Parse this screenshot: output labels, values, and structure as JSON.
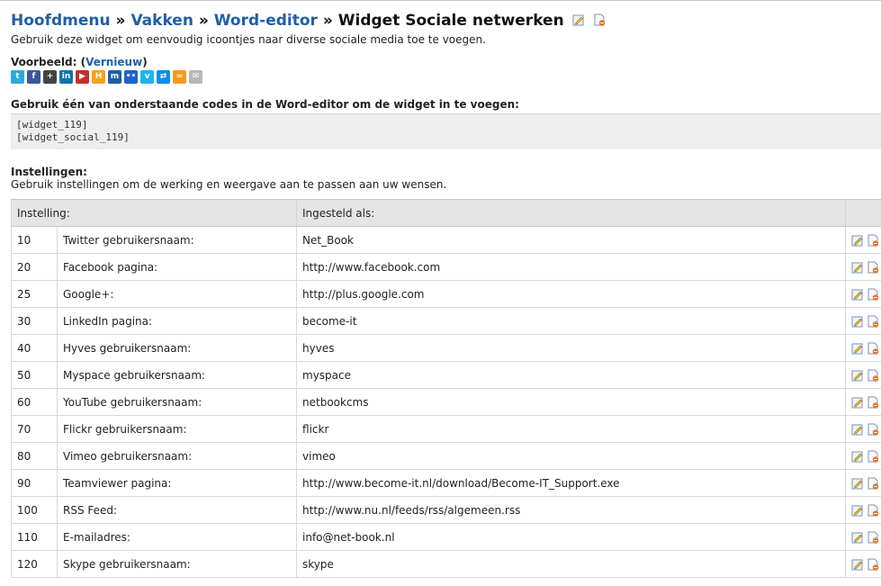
{
  "breadcrumb": {
    "home": "Hoofdmenu",
    "sep1": "»",
    "subjects": "Vakken",
    "sep2": "»",
    "editor": "Word-editor",
    "sep3": "»",
    "current": "Widget Sociale netwerken"
  },
  "intro": "Gebruik deze widget om eenvoudig icoontjes naar diverse sociale media toe te voegen.",
  "preview": {
    "label": "Voorbeeld:",
    "open": "(",
    "refresh_link": "Vernieuw",
    "close": ")",
    "icons": [
      {
        "name": "twitter-icon",
        "glyph": "t",
        "color": "#2aa9e0"
      },
      {
        "name": "facebook-icon",
        "glyph": "f",
        "color": "#3b5998"
      },
      {
        "name": "google-plus-icon",
        "glyph": "+",
        "color": "#444444"
      },
      {
        "name": "linkedin-icon",
        "glyph": "in",
        "color": "#0e76a8"
      },
      {
        "name": "youtube-icon",
        "glyph": "▶",
        "color": "#c4302b"
      },
      {
        "name": "hyves-icon",
        "glyph": "H",
        "color": "#f7a21b"
      },
      {
        "name": "myspace-icon",
        "glyph": "m",
        "color": "#1b5ea5"
      },
      {
        "name": "flickr-icon",
        "glyph": "••",
        "color": "#1e64c8"
      },
      {
        "name": "vimeo-icon",
        "glyph": "v",
        "color": "#1ab7ea"
      },
      {
        "name": "teamviewer-icon",
        "glyph": "⇄",
        "color": "#0e8ee9"
      },
      {
        "name": "rss-icon",
        "glyph": "≈",
        "color": "#f8991d"
      },
      {
        "name": "email-icon",
        "glyph": "✉",
        "color": "#b8b8b8"
      }
    ]
  },
  "codes": {
    "title": "Gebruik één van onderstaande codes in de Word-editor om de widget in te voegen:",
    "lines": [
      "[widget_119]",
      "[widget_social_119]"
    ]
  },
  "settings": {
    "title": "Instellingen:",
    "description": "Gebruik instellingen om de werking en weergave aan te passen aan uw wensen.",
    "col_setting": "Instelling:",
    "col_value": "Ingesteld als:",
    "rows": [
      {
        "order": "10",
        "name": "Twitter gebruikersnaam:",
        "value": "Net_Book"
      },
      {
        "order": "20",
        "name": "Facebook pagina:",
        "value": "http://www.facebook.com"
      },
      {
        "order": "25",
        "name": "Google+:",
        "value": "http://plus.google.com"
      },
      {
        "order": "30",
        "name": "LinkedIn pagina:",
        "value": "become-it"
      },
      {
        "order": "40",
        "name": "Hyves gebruikersnaam:",
        "value": "hyves"
      },
      {
        "order": "50",
        "name": "Myspace gebruikersnaam:",
        "value": "myspace"
      },
      {
        "order": "60",
        "name": "YouTube gebruikersnaam:",
        "value": "netbookcms"
      },
      {
        "order": "70",
        "name": "Flickr gebruikersnaam:",
        "value": "flickr"
      },
      {
        "order": "80",
        "name": "Vimeo gebruikersnaam:",
        "value": "vimeo"
      },
      {
        "order": "90",
        "name": "Teamviewer pagina:",
        "value": "http://www.become-it.nl/download/Become-IT_Support.exe"
      },
      {
        "order": "100",
        "name": "RSS Feed:",
        "value": "http://www.nu.nl/feeds/rss/algemeen.rss"
      },
      {
        "order": "110",
        "name": "E-mailadres:",
        "value": "info@net-book.nl"
      },
      {
        "order": "120",
        "name": "Skype gebruikersnaam:",
        "value": "skype"
      }
    ]
  }
}
